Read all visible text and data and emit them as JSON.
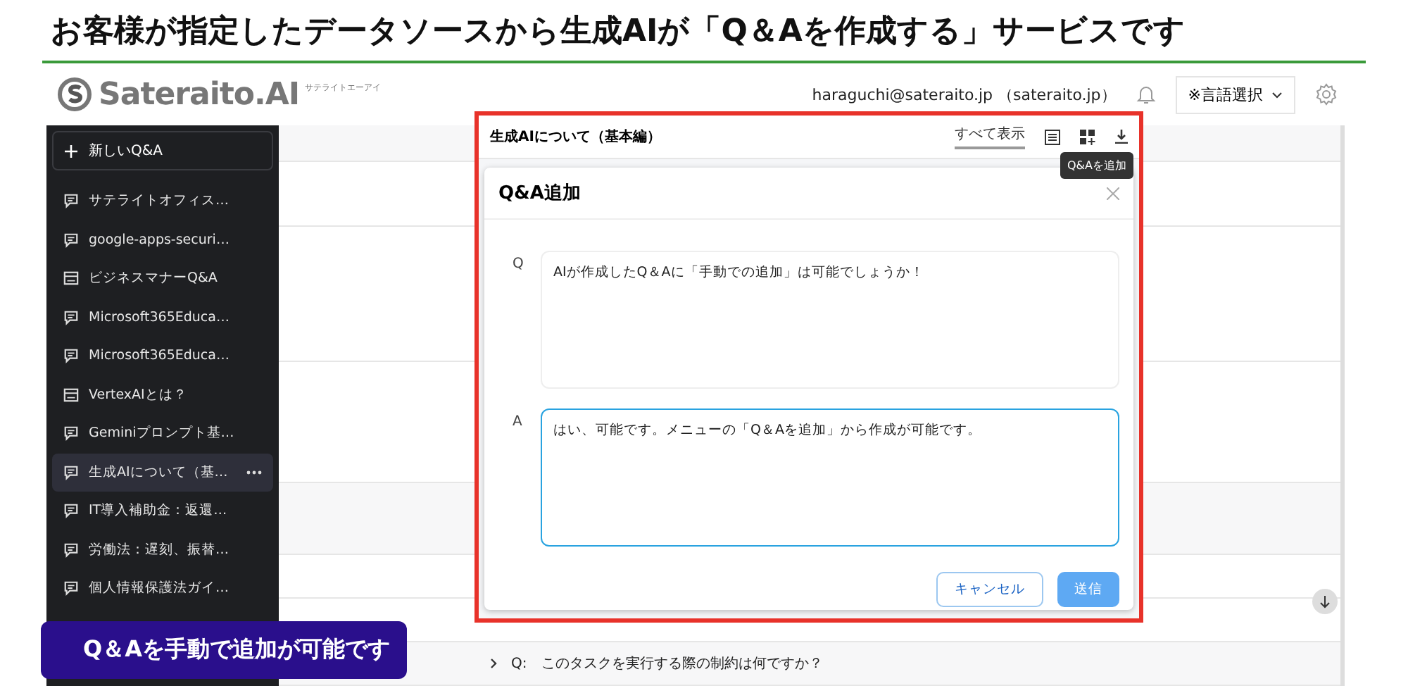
{
  "headline": "お客様が指定したデータソースから生成AIが「Q＆Aを作成する」サービスです",
  "logo": {
    "name": "Sateraito.AI",
    "reading": "サテライトエーアイ"
  },
  "header": {
    "account": "haraguchi@sateraito.jp （sateraito.jp）",
    "language_select": "※言語選択"
  },
  "sidebar": {
    "new_button": "新しいQ&A",
    "items": [
      {
        "kind": "chat",
        "label": "サテライトオフィス…",
        "selected": false
      },
      {
        "kind": "chat",
        "label": "google-apps-securi…",
        "selected": false
      },
      {
        "kind": "doc",
        "label": "ビジネスマナーQ&A",
        "selected": false
      },
      {
        "kind": "chat",
        "label": "Microsoft365Educa…",
        "selected": false
      },
      {
        "kind": "chat",
        "label": "Microsoft365Educa…",
        "selected": false
      },
      {
        "kind": "doc",
        "label": "VertexAIとは？",
        "selected": false
      },
      {
        "kind": "chat",
        "label": "Geminiプロンプト基…",
        "selected": false
      },
      {
        "kind": "chat",
        "label": "生成AIについて（基…",
        "selected": true
      },
      {
        "kind": "chat",
        "label": "IT導入補助金：返還…",
        "selected": false
      },
      {
        "kind": "chat",
        "label": "労働法：遅刻、振替…",
        "selected": false
      },
      {
        "kind": "chat",
        "label": "個人情報保護法ガイ…",
        "selected": false
      }
    ]
  },
  "panel": {
    "title": "生成AIについて（基本編）",
    "show_all": "すべて表示",
    "tooltip": "Q&Aを追加"
  },
  "dialog": {
    "title": "Q&A追加",
    "q_label": "Q",
    "q_value": "AIが作成したQ＆Aに「手動での追加」は可能でしょうか！",
    "a_label": "A",
    "a_value": "はい、可能です。メニューの「Q＆Aを追加」から作成が可能です。",
    "cancel": "キャンセル",
    "submit": "送信"
  },
  "list_row": {
    "prefix": "Q:",
    "text": "このタスクを実行する際の制約は何ですか？"
  },
  "callout": "Q＆Aを手動で追加が可能です"
}
